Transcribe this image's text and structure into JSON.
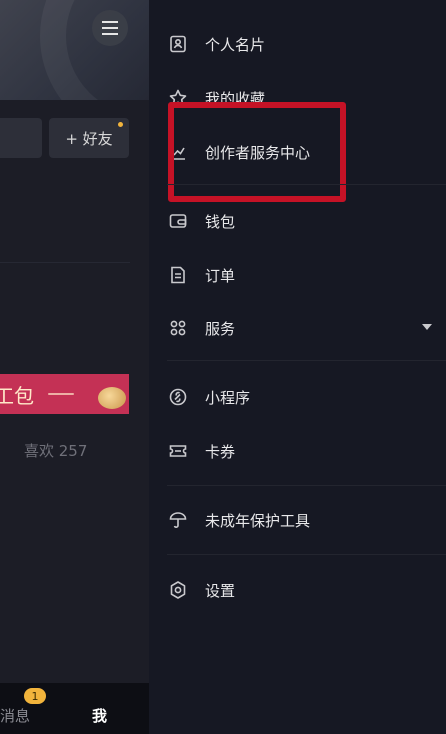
{
  "profile": {
    "add_friend_label": "+ 好友",
    "banner_text": "工包",
    "likes_text": "喜欢 257",
    "menu_icon": "hamburger-icon"
  },
  "bottom_nav": {
    "messages_label": "消息",
    "messages_badge": "1",
    "me_label": "我"
  },
  "drawer": {
    "items": [
      {
        "label": "个人名片",
        "icon": "id-card-icon"
      },
      {
        "label": "我的收藏",
        "icon": "star-icon"
      },
      {
        "label": "创作者服务中心",
        "icon": "chart-line-icon"
      },
      {
        "label": "钱包",
        "icon": "wallet-icon"
      },
      {
        "label": "订单",
        "icon": "order-icon"
      },
      {
        "label": "服务",
        "icon": "grid-icon"
      },
      {
        "label": "小程序",
        "icon": "link-icon"
      },
      {
        "label": "卡券",
        "icon": "ticket-icon"
      },
      {
        "label": "未成年保护工具",
        "icon": "umbrella-icon"
      },
      {
        "label": "设置",
        "icon": "settings-icon"
      }
    ],
    "highlight_color": "#c51226"
  }
}
